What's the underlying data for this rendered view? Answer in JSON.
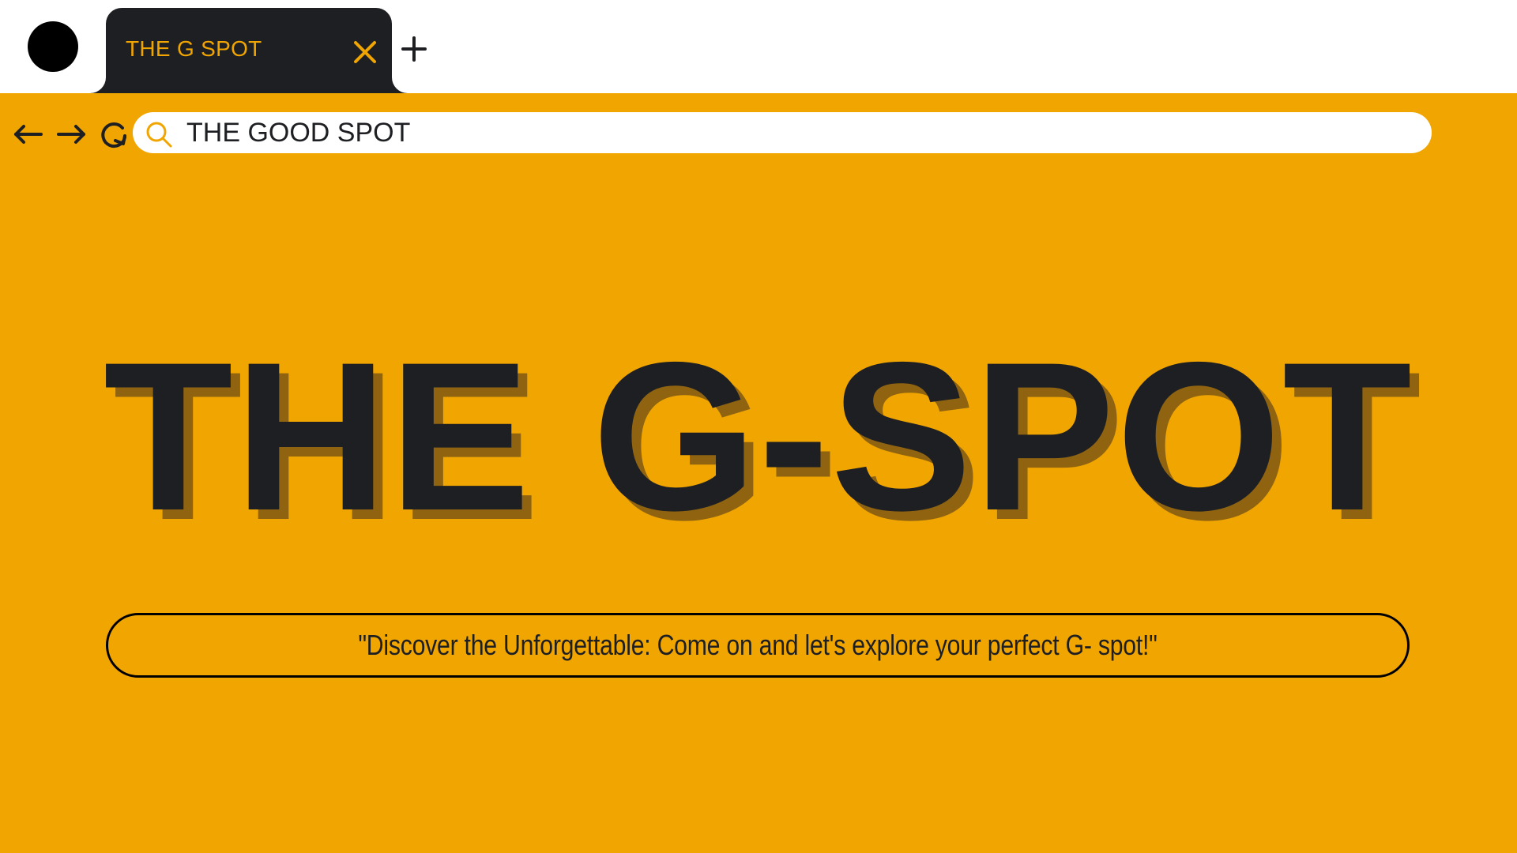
{
  "tab": {
    "title": "THE G SPOT",
    "close_icon": "close-icon",
    "new_tab_icon": "plus-icon"
  },
  "nav": {
    "back_icon": "arrow-left-icon",
    "forward_icon": "arrow-right-icon",
    "reload_icon": "reload-icon"
  },
  "address_bar": {
    "value": "THE GOOD SPOT",
    "icon": "search-icon"
  },
  "hero": {
    "title": "THE G-SPOT"
  },
  "tagline": {
    "text": "\"Discover the Unforgettable: Come on and let's explore your perfect G- spot!\""
  },
  "colors": {
    "accent": "#f0a500",
    "dark": "#1e1f22",
    "shadow": "#8f6310",
    "background_top": "#ffffff"
  }
}
